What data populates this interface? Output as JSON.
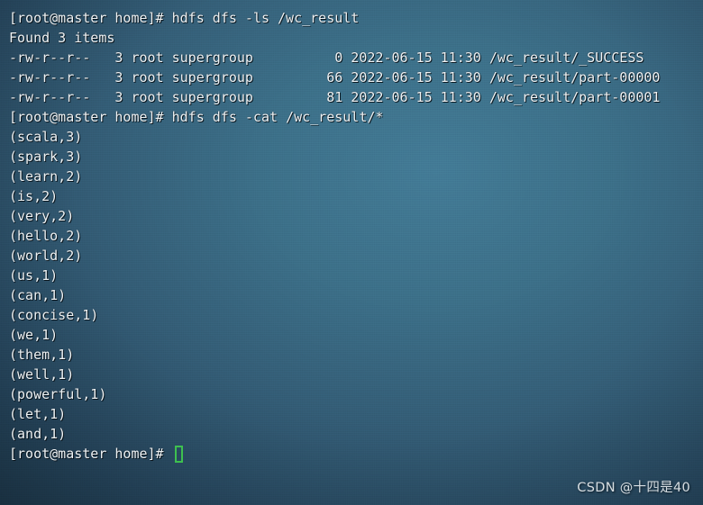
{
  "terminal": {
    "prompt": "[root@master home]#",
    "cursor_color": "#3ec04f",
    "text_color": "#eff3f5",
    "background_color": "#3c6f88",
    "lines": [
      "[root@master home]# hdfs dfs -ls /wc_result",
      "Found 3 items",
      "-rw-r--r--   3 root supergroup          0 2022-06-15 11:30 /wc_result/_SUCCESS",
      "-rw-r--r--   3 root supergroup         66 2022-06-15 11:30 /wc_result/part-00000",
      "-rw-r--r--   3 root supergroup         81 2022-06-15 11:30 /wc_result/part-00001",
      "[root@master home]# hdfs dfs -cat /wc_result/*",
      "(scala,3)",
      "(spark,3)",
      "(learn,2)",
      "(is,2)",
      "(very,2)",
      "(hello,2)",
      "(world,2)",
      "(us,1)",
      "(can,1)",
      "(concise,1)",
      "(we,1)",
      "(them,1)",
      "(well,1)",
      "(powerful,1)",
      "(let,1)",
      "(and,1)"
    ],
    "active_prompt": "[root@master home]# ",
    "commands": [
      "hdfs dfs -ls /wc_result",
      "hdfs dfs -cat /wc_result/*"
    ],
    "listing": {
      "header": "Found 3 items",
      "item_count": "3",
      "columns": [
        "permissions",
        "replication",
        "owner",
        "group",
        "size",
        "date",
        "time",
        "path"
      ],
      "rows": [
        {
          "permissions": "-rw-r--r--",
          "replication": "3",
          "owner": "root",
          "group": "supergroup",
          "size": "0",
          "date": "2022-06-15",
          "time": "11:30",
          "path": "/wc_result/_SUCCESS"
        },
        {
          "permissions": "-rw-r--r--",
          "replication": "3",
          "owner": "root",
          "group": "supergroup",
          "size": "66",
          "date": "2022-06-15",
          "time": "11:30",
          "path": "/wc_result/part-00000"
        },
        {
          "permissions": "-rw-r--r--",
          "replication": "3",
          "owner": "root",
          "group": "supergroup",
          "size": "81",
          "date": "2022-06-15",
          "time": "11:30",
          "path": "/wc_result/part-00001"
        }
      ]
    },
    "word_counts": [
      {
        "word": "scala",
        "count": "3"
      },
      {
        "word": "spark",
        "count": "3"
      },
      {
        "word": "learn",
        "count": "2"
      },
      {
        "word": "is",
        "count": "2"
      },
      {
        "word": "very",
        "count": "2"
      },
      {
        "word": "hello",
        "count": "2"
      },
      {
        "word": "world",
        "count": "2"
      },
      {
        "word": "us",
        "count": "1"
      },
      {
        "word": "can",
        "count": "1"
      },
      {
        "word": "concise",
        "count": "1"
      },
      {
        "word": "we",
        "count": "1"
      },
      {
        "word": "them",
        "count": "1"
      },
      {
        "word": "well",
        "count": "1"
      },
      {
        "word": "powerful",
        "count": "1"
      },
      {
        "word": "let",
        "count": "1"
      },
      {
        "word": "and",
        "count": "1"
      }
    ]
  },
  "watermark": {
    "text": "CSDN @十四是40"
  }
}
